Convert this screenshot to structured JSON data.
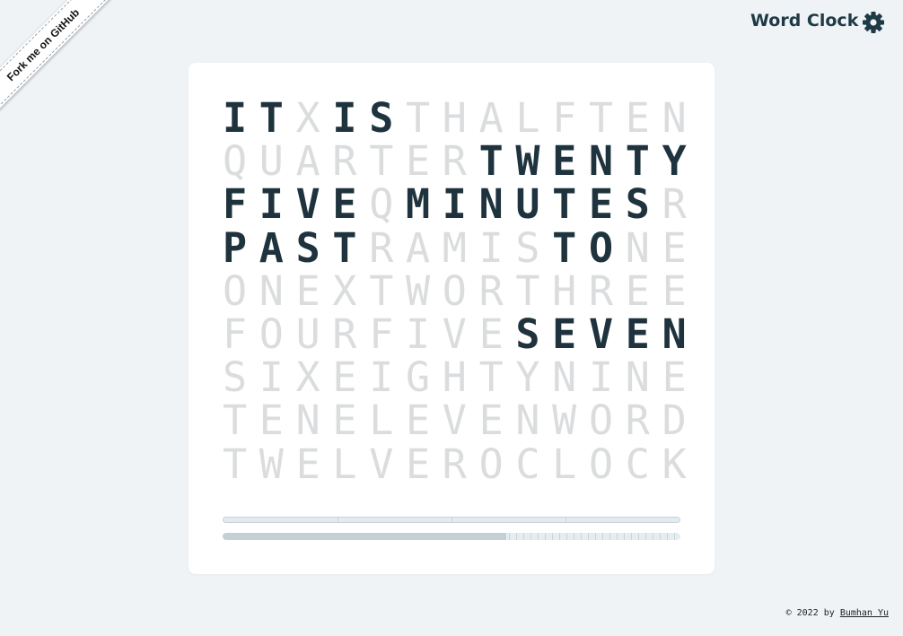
{
  "ribbon": {
    "label": "Fork me on GitHub"
  },
  "header": {
    "title": "Word Clock",
    "settings_icon": "gear-icon",
    "accent": "#1f3a47"
  },
  "clock": {
    "rows": [
      "ITXISTHALFTEN",
      "QUARTERTWENTY",
      "FIVEQMINUTESR",
      "PASTRAMISTONE",
      "ONEXTWORTHREE",
      "FOURFIVESEVEN",
      "SIXEIGHTYNINE",
      "TENELEVENWORD",
      "TWELVEROCLOCK"
    ],
    "active": [
      [
        0,
        0
      ],
      [
        0,
        1
      ],
      [
        0,
        3
      ],
      [
        0,
        4
      ],
      [
        1,
        7
      ],
      [
        1,
        8
      ],
      [
        1,
        9
      ],
      [
        1,
        10
      ],
      [
        1,
        11
      ],
      [
        1,
        12
      ],
      [
        2,
        0
      ],
      [
        2,
        1
      ],
      [
        2,
        2
      ],
      [
        2,
        3
      ],
      [
        2,
        5
      ],
      [
        2,
        6
      ],
      [
        2,
        7
      ],
      [
        2,
        8
      ],
      [
        2,
        9
      ],
      [
        2,
        10
      ],
      [
        2,
        11
      ],
      [
        3,
        0
      ],
      [
        3,
        1
      ],
      [
        3,
        2
      ],
      [
        3,
        3
      ],
      [
        3,
        9
      ],
      [
        3,
        10
      ],
      [
        5,
        8
      ],
      [
        5,
        9
      ],
      [
        5,
        10
      ],
      [
        5,
        11
      ],
      [
        5,
        12
      ]
    ],
    "active_color": "#1e333d",
    "inactive_color": "#dadcdd"
  },
  "progress": {
    "top_segments": 4,
    "bottom_fill_fraction": 0.62
  },
  "footer": {
    "prefix": "© 2022 by ",
    "author": "Bumhan Yu"
  }
}
